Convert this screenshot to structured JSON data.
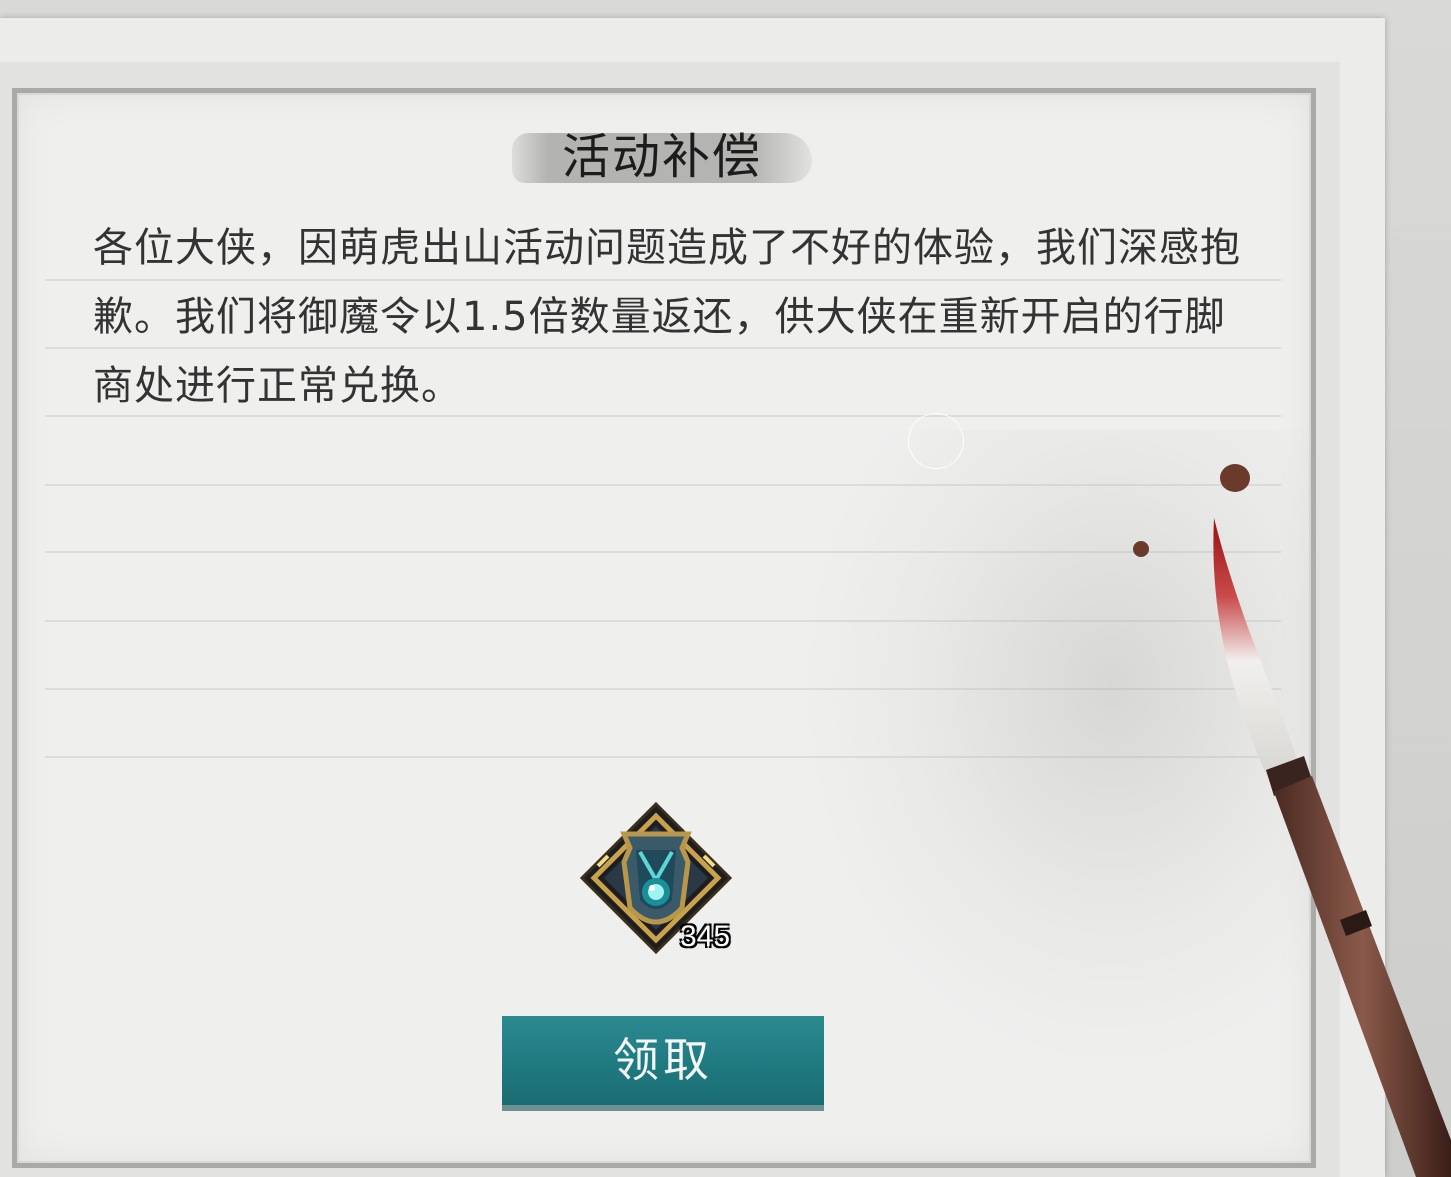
{
  "dialog": {
    "title": "活动补偿",
    "body": "各位大侠，因萌虎出山活动问题造成了不好的体验，我们深感抱歉。我们将御魔令以1.5倍数量返还，供大侠在重新开启的行脚商处进行正常兑换。"
  },
  "reward": {
    "icon": "yumoling-token-icon",
    "count": "345"
  },
  "actions": {
    "claim_label": "领取"
  },
  "colors": {
    "button": "#1f7a80",
    "paper": "#efefee",
    "title_text": "#1c1c1c",
    "body_text": "#333333"
  }
}
